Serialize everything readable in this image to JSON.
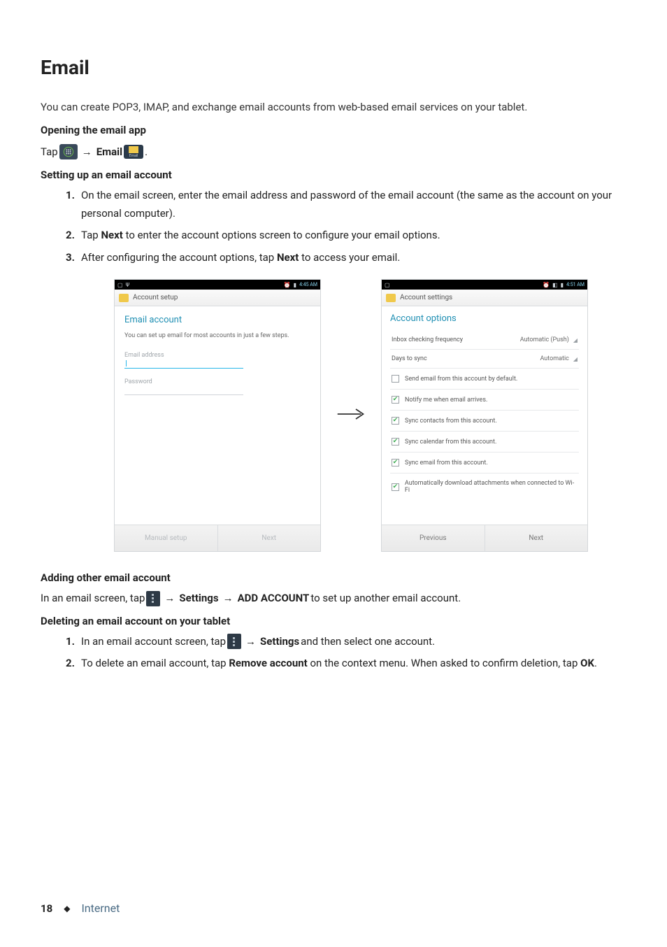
{
  "heading": "Email",
  "intro": "You can create POP3, IMAP, and exchange email accounts from web-based email services on your tablet.",
  "open_section": {
    "title": "Opening the email app",
    "tap_prefix": "Tap ",
    "arrow": "→",
    "email_label": "Email",
    "email_icon_caption": "Email",
    "period": "."
  },
  "setup_section": {
    "title": "Setting up an email account",
    "steps": [
      {
        "pre": "On the email screen, enter the email address and password of the email account (the same as the account on your personal computer)."
      },
      {
        "pre": "Tap ",
        "bold1": "Next",
        "post1": " to enter the account options screen to configure your email options."
      },
      {
        "pre": "After configuring the account options, tap ",
        "bold1": "Next",
        "post1": " to access your email."
      }
    ]
  },
  "phone_left": {
    "status_time": "4:45 AM",
    "titlebar": "Account setup",
    "section": "Email account",
    "hint": "You can set up email for most accounts in just a few steps.",
    "field_email": "Email address",
    "field_password": "Password",
    "btn_left": "Manual setup",
    "btn_right": "Next"
  },
  "phone_right": {
    "status_time": "4:51 AM",
    "titlebar": "Account settings",
    "section": "Account options",
    "opt1_label": "Inbox checking frequency",
    "opt1_value": "Automatic (Push)",
    "opt2_label": "Days to sync",
    "opt2_value": "Automatic",
    "chk1": "Send email from this account by default.",
    "chk2": "Notify me when email arrives.",
    "chk3": "Sync contacts from this account.",
    "chk4": "Sync calendar from this account.",
    "chk5": "Sync email from this account.",
    "chk6": "Automatically download attachments when connected to Wi-Fi",
    "btn_left": "Previous",
    "btn_right": "Next"
  },
  "add_section": {
    "title": "Adding other email account",
    "pre": "In an email screen, tap ",
    "arrow": "→",
    "settings": "Settings",
    "add_account": "ADD ACCOUNT",
    "post": " to set up another email account."
  },
  "delete_section": {
    "title": "Deleting an email account on your tablet",
    "steps": [
      {
        "pre": "In an email account screen, tap ",
        "arrow": "→",
        "bold1": "Settings",
        "post1": " and then select one account."
      },
      {
        "pre": "To delete an email account, tap ",
        "bold1": "Remove account",
        "post1": " on the context menu. When asked to confirm deletion, tap ",
        "bold2": "OK",
        "post2": "."
      }
    ]
  },
  "footer": {
    "page": "18",
    "diamond": "◆",
    "section": "Internet"
  }
}
